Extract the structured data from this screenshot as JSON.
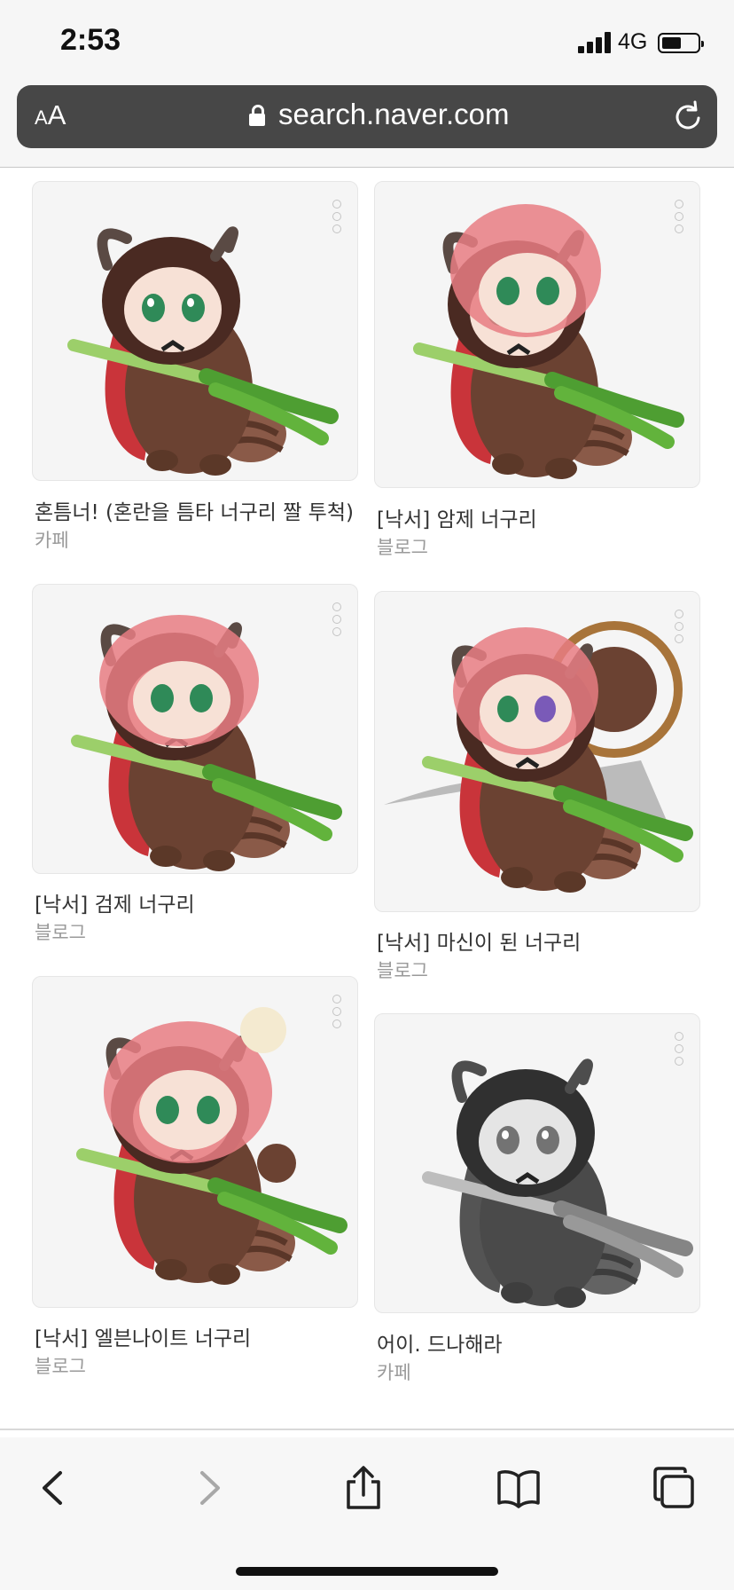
{
  "status_bar": {
    "time": "2:53",
    "network": "4G",
    "battery_level": 0.55
  },
  "browser": {
    "reader_small": "A",
    "reader_big": "A",
    "url": "search.naver.com"
  },
  "results": [
    {
      "title": "혼틈너! (혼란을 틈타 너구리 짤 투척)",
      "source": "카페"
    },
    {
      "title": "[낙서] 암제 너구리",
      "source": "블로그"
    },
    {
      "title": "[낙서] 검제 너구리",
      "source": "블로그"
    },
    {
      "title": "[낙서] 마신이 된 너구리",
      "source": "블로그"
    },
    {
      "title": "[낙서] 엘븐나이트 너구리",
      "source": "블로그"
    },
    {
      "title": "어이. 드나해라",
      "source": "카페"
    }
  ]
}
